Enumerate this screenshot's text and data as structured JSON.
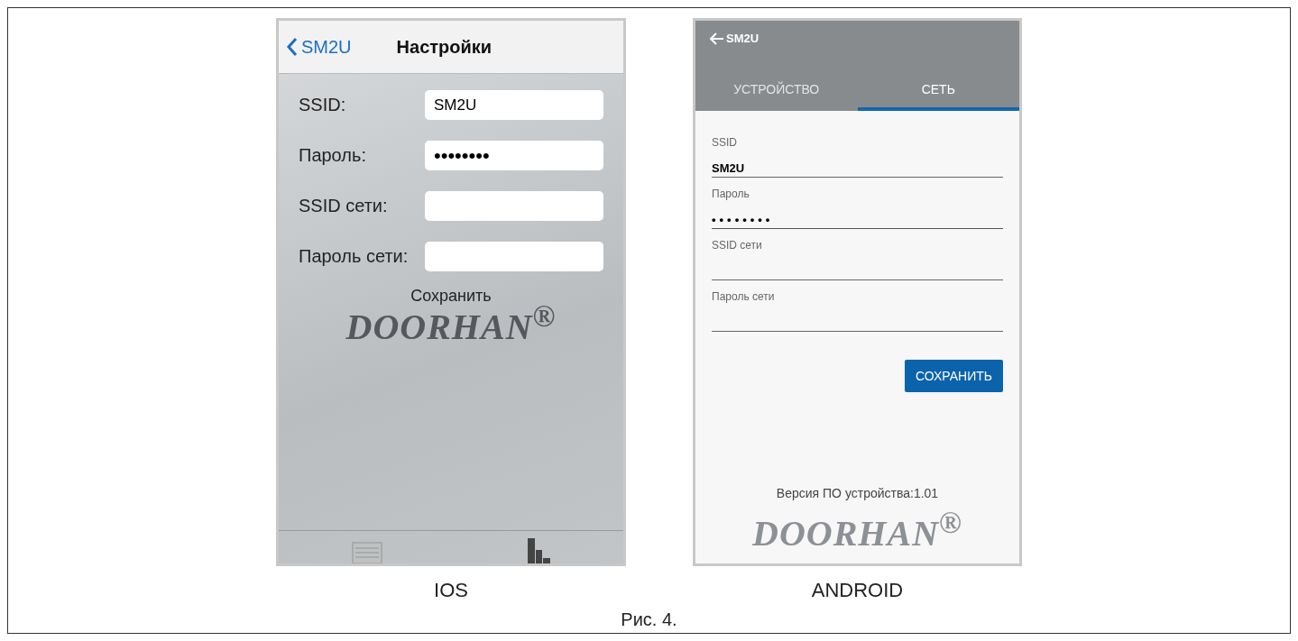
{
  "ios": {
    "back": "SM2U",
    "title": "Настройки",
    "fields": [
      {
        "label": "SSID:",
        "value": "SM2U",
        "kind": "text"
      },
      {
        "label": "Пароль:",
        "value": "••••••••",
        "kind": "password"
      },
      {
        "label": "SSID сети:",
        "kind": "text"
      },
      {
        "label": "Пароль сети:",
        "kind": "text"
      }
    ],
    "save": "Сохранить",
    "logo": "DOORHAN$^{®}$",
    "caption": "IOS"
  },
  "android": {
    "back": "SM2U",
    "tabs": [
      {
        "label": "УСТРОЙСТВО",
        "selected": false
      },
      {
        "label": "СЕТЬ",
        "selected": true
      }
    ],
    "fields": [
      {
        "label": "SSID",
        "value": "SM2U",
        "kind": "text"
      },
      {
        "label": "Пароль",
        "value": "••••••••",
        "kind": "password"
      },
      {
        "label": "SSID сети",
        "kind": "text"
      },
      {
        "label": "Пароль  сети",
        "kind": "text"
      }
    ],
    "save": "СОХРАНИТЬ",
    "version": "Версия ПО устройства:1.01",
    "logo": "DOORHAN$^{®}$",
    "caption": "ANDROID"
  },
  "figure_caption": "Рис. 4."
}
